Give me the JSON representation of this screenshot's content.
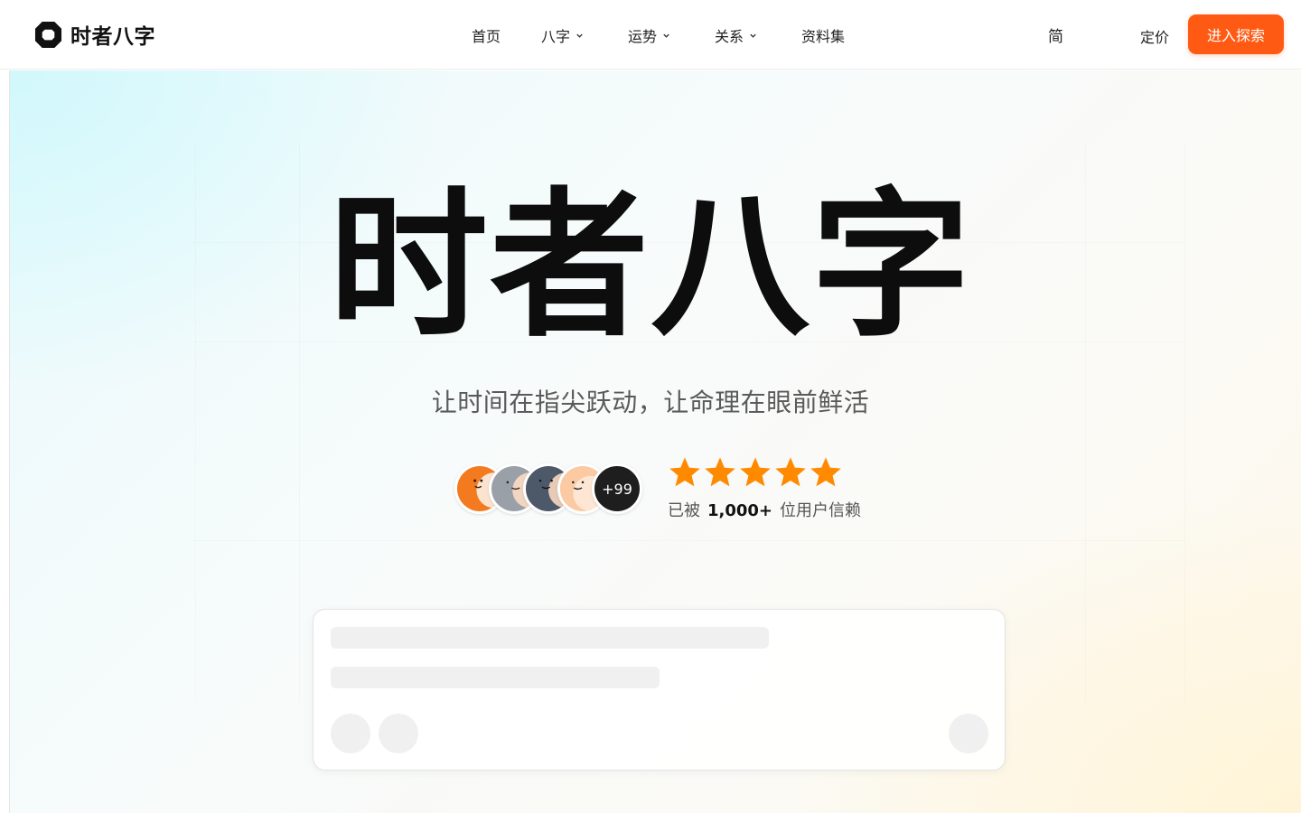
{
  "header": {
    "logo_text": "时者八字",
    "nav": [
      {
        "label": "首页",
        "has_dropdown": false
      },
      {
        "label": "八字",
        "has_dropdown": true
      },
      {
        "label": "运势",
        "has_dropdown": true
      },
      {
        "label": "关系",
        "has_dropdown": true
      },
      {
        "label": "资料集",
        "has_dropdown": false
      }
    ],
    "language": "简",
    "pricing": "定价",
    "cta": "进入探索"
  },
  "hero": {
    "title": "时者八字",
    "subtitle": "让时间在指尖跃动，让命理在眼前鲜活",
    "avatars_more": "+99",
    "rating_stars": 5,
    "trust_prefix": "已被",
    "trust_count": "1,000+",
    "trust_suffix": "位用户信赖"
  },
  "colors": {
    "accent": "#ff5a14",
    "star": "#ff8a00",
    "title": "#0d0d0d"
  },
  "icons": [
    "logo-icon",
    "chevron-down-icon",
    "star-icon"
  ]
}
